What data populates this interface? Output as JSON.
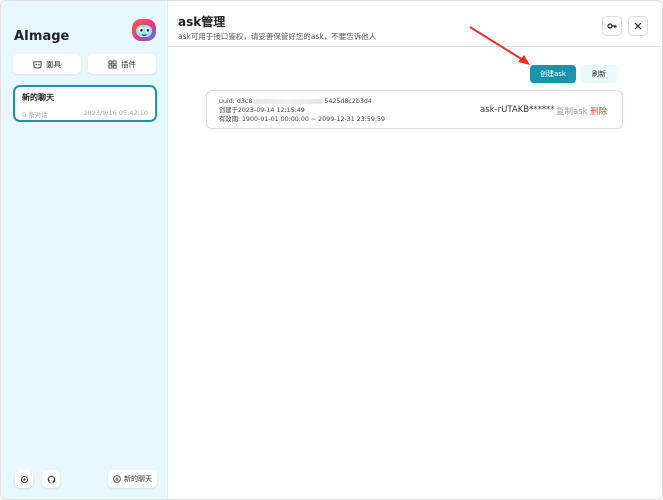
{
  "sidebar": {
    "brand": "AImage",
    "logo_icon": "bot-face-logo",
    "mask_button": "面具",
    "plugin_button": "插件",
    "chats": [
      {
        "title": "新的聊天",
        "count": "0 条对话",
        "time": "2023/9/16 05:42:10"
      }
    ],
    "new_chat_button": "新的聊天",
    "colors": {
      "accent": "#1d93ab",
      "sidebar_bg": "#e7f8ff"
    }
  },
  "header": {
    "title": "ask管理",
    "subtitle": "ask可用于接口鉴权，请妥善保管好您的ask，不要告诉他人"
  },
  "toolbar": {
    "create_label": "创建ask",
    "refresh_label": "刷新"
  },
  "keys": [
    {
      "uuid_prefix": "uuid: d3c8",
      "uuid_suffix": "5425d8c2b3d4",
      "created": "创建于2023-09-14 12:15:49",
      "validity": "有效期:  1900-01-01 00:00:00 ~ 2099-12-31 23:59:59",
      "value": "ask-rUTAKB******",
      "copy_label": "复制ask",
      "delete_label": "删除"
    }
  ]
}
